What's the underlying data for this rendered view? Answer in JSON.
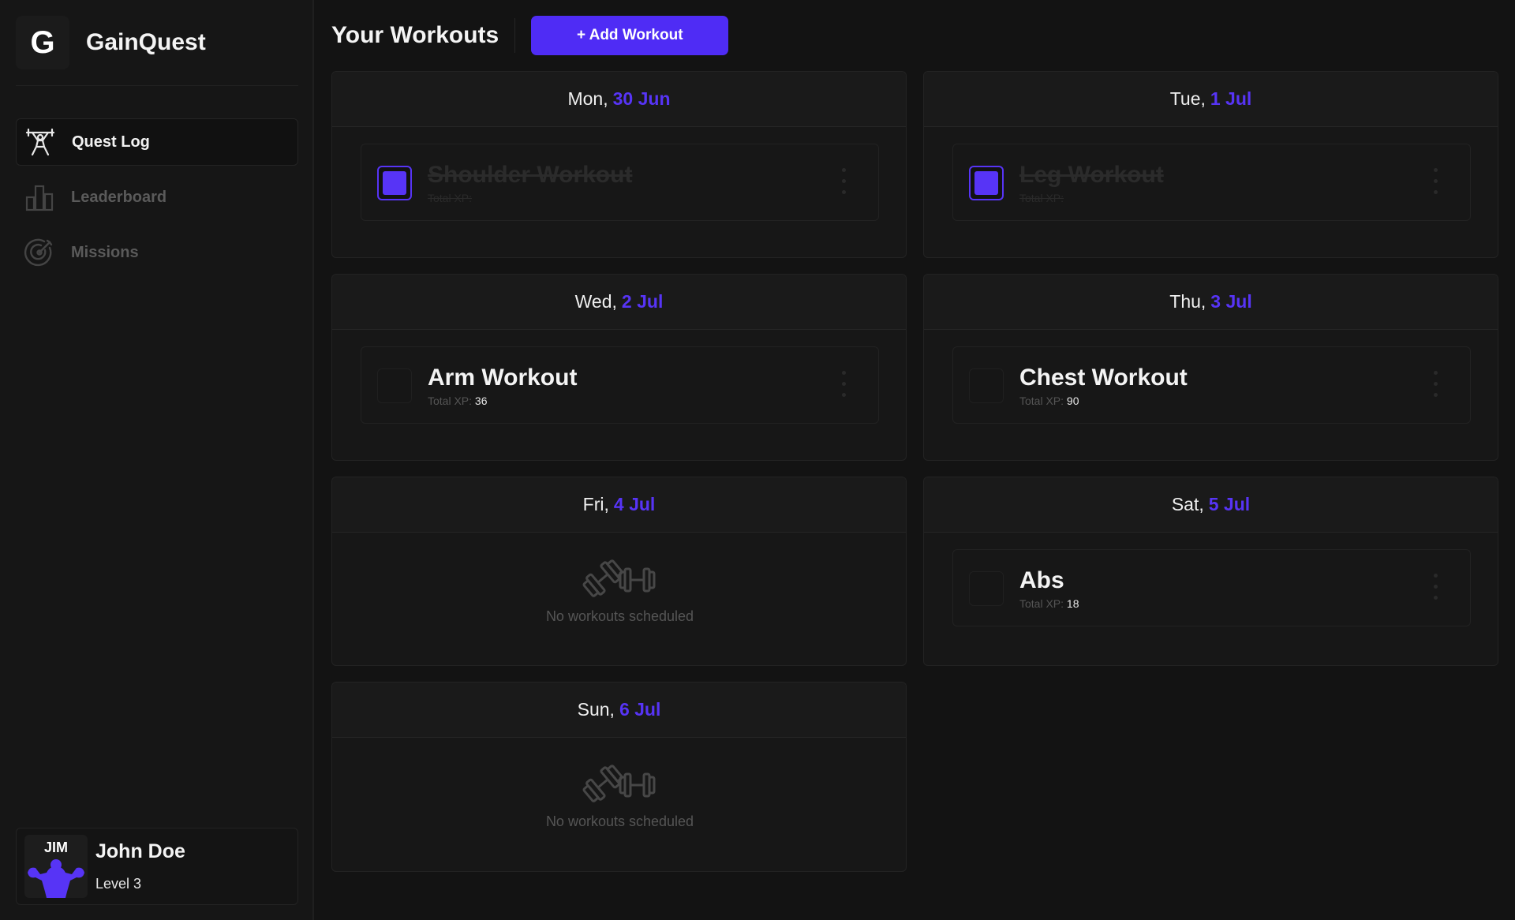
{
  "app": {
    "name": "GainQuest",
    "logo_letter": "G",
    "accent": "#4f2cf5"
  },
  "sidebar": {
    "items": [
      {
        "label": "Quest Log",
        "icon": "weightlifter-icon",
        "active": true
      },
      {
        "label": "Leaderboard",
        "icon": "bar-chart-icon",
        "active": false
      },
      {
        "label": "Missions",
        "icon": "target-icon",
        "active": false
      }
    ]
  },
  "profile": {
    "name": "John Doe",
    "level": "Level 3",
    "avatar_text": "JIM"
  },
  "header": {
    "title": "Your Workouts",
    "add_button": "+ Add Workout"
  },
  "xp_label": "Total XP:",
  "days": [
    {
      "day": "Mon,",
      "date": "30 Jun",
      "workout": {
        "name": "Shoulder Workout",
        "xp": "",
        "completed": true
      }
    },
    {
      "day": "Tue,",
      "date": "1 Jul",
      "workout": {
        "name": "Leg Workout",
        "xp": "",
        "completed": true
      }
    },
    {
      "day": "Wed,",
      "date": "2 Jul",
      "workout": {
        "name": "Arm Workout",
        "xp": "36",
        "completed": false
      }
    },
    {
      "day": "Thu,",
      "date": "3 Jul",
      "workout": {
        "name": "Chest Workout",
        "xp": "90",
        "completed": false
      }
    },
    {
      "day": "Fri,",
      "date": "4 Jul",
      "empty_text": "No workouts scheduled"
    },
    {
      "day": "Sat,",
      "date": "5 Jul",
      "workout": {
        "name": "Abs",
        "xp": "18",
        "completed": false
      }
    },
    {
      "day": "Sun,",
      "date": "6 Jul",
      "empty_text": "No workouts scheduled"
    }
  ]
}
